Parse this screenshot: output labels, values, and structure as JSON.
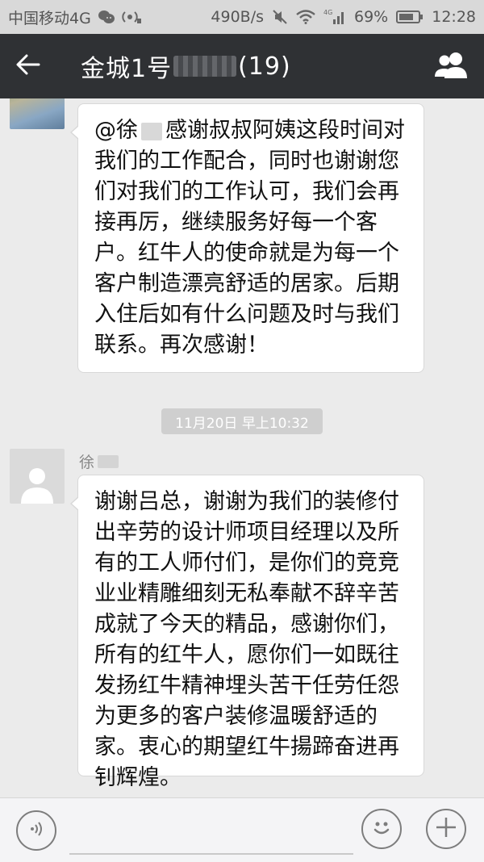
{
  "status_bar": {
    "carrier": "中国移动4G",
    "speed": "490B/s",
    "battery": "69%",
    "time": "12:28",
    "network_badge": "4G"
  },
  "header": {
    "title_prefix": "金城1号",
    "title_count": "(19)"
  },
  "messages": [
    {
      "mention": "@徐",
      "text": "感谢叔叔阿姨这段时间对我们的工作配合，同时也谢谢您们对我们的工作认可，我们会再接再厉，继续服务好每一个客户。红牛人的使命就是为每一个客户制造漂亮舒适的居家。后期入住后如有什么问题及时与我们联系。再次感谢！"
    },
    {
      "sender": "徐",
      "text": "谢谢吕总，谢谢为我们的装修付出辛劳的设计师项目经理以及所有的工人师付们，是你们的竞竞业业精雕细刻无私奉献不辞辛苦成就了今天的精品，感谢你们，所有的红牛人，愿你们一如既往发扬红牛精神埋头苦干任劳任怨为更多的客户装修温暖舒适的家。衷心的期望红牛揚蹄奋进再钊辉煌。"
    }
  ],
  "timestamp": "11月20日 早上10:32",
  "icons": {
    "back": "back-arrow-icon",
    "group": "group-members-icon",
    "voice": "voice-icon",
    "emoji": "emoji-icon",
    "plus": "plus-icon"
  },
  "colors": {
    "title_bar": "#2f3134",
    "chat_bg": "#ebebeb",
    "bubble": "#ffffff"
  }
}
